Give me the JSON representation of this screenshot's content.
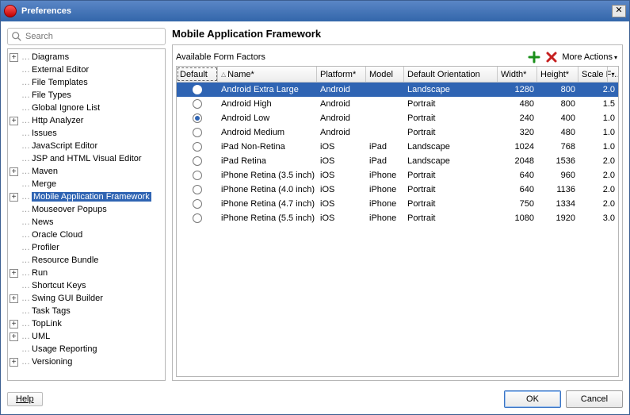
{
  "window": {
    "title": "Preferences"
  },
  "search": {
    "placeholder": "Search"
  },
  "tree": {
    "items": [
      {
        "label": "Diagrams",
        "expandable": true
      },
      {
        "label": "External Editor",
        "expandable": false
      },
      {
        "label": "File Templates",
        "expandable": false
      },
      {
        "label": "File Types",
        "expandable": false
      },
      {
        "label": "Global Ignore List",
        "expandable": false
      },
      {
        "label": "Http Analyzer",
        "expandable": true
      },
      {
        "label": "Issues",
        "expandable": false
      },
      {
        "label": "JavaScript Editor",
        "expandable": false
      },
      {
        "label": "JSP and HTML Visual Editor",
        "expandable": false
      },
      {
        "label": "Maven",
        "expandable": true
      },
      {
        "label": "Merge",
        "expandable": false
      },
      {
        "label": "Mobile Application Framework",
        "expandable": true,
        "selected": true
      },
      {
        "label": "Mouseover Popups",
        "expandable": false
      },
      {
        "label": "News",
        "expandable": false
      },
      {
        "label": "Oracle Cloud",
        "expandable": false
      },
      {
        "label": "Profiler",
        "expandable": false
      },
      {
        "label": "Resource Bundle",
        "expandable": false
      },
      {
        "label": "Run",
        "expandable": true
      },
      {
        "label": "Shortcut Keys",
        "expandable": false
      },
      {
        "label": "Swing GUI Builder",
        "expandable": true
      },
      {
        "label": "Task Tags",
        "expandable": false
      },
      {
        "label": "TopLink",
        "expandable": true
      },
      {
        "label": "UML",
        "expandable": true
      },
      {
        "label": "Usage Reporting",
        "expandable": false
      },
      {
        "label": "Versioning",
        "expandable": true
      }
    ]
  },
  "main": {
    "heading": "Mobile Application Framework",
    "available_label": "Available Form Factors",
    "more_actions": "More Actions",
    "columns": {
      "default": "Default",
      "name": "Name*",
      "platform": "Platform*",
      "model": "Model",
      "orientation": "Default Orientation",
      "width": "Width*",
      "height": "Height*",
      "scale": "Scale F…"
    },
    "rows": [
      {
        "name": "Android Extra Large",
        "platform": "Android",
        "model": "",
        "orientation": "Landscape",
        "width": "1280",
        "height": "800",
        "scale": "2.0",
        "checked": false,
        "selected": true
      },
      {
        "name": "Android High",
        "platform": "Android",
        "model": "",
        "orientation": "Portrait",
        "width": "480",
        "height": "800",
        "scale": "1.5",
        "checked": false
      },
      {
        "name": "Android Low",
        "platform": "Android",
        "model": "",
        "orientation": "Portrait",
        "width": "240",
        "height": "400",
        "scale": "1.0",
        "checked": true
      },
      {
        "name": "Android Medium",
        "platform": "Android",
        "model": "",
        "orientation": "Portrait",
        "width": "320",
        "height": "480",
        "scale": "1.0",
        "checked": false
      },
      {
        "name": "iPad Non-Retina",
        "platform": "iOS",
        "model": "iPad",
        "orientation": "Landscape",
        "width": "1024",
        "height": "768",
        "scale": "1.0",
        "checked": false
      },
      {
        "name": "iPad Retina",
        "platform": "iOS",
        "model": "iPad",
        "orientation": "Landscape",
        "width": "2048",
        "height": "1536",
        "scale": "2.0",
        "checked": false
      },
      {
        "name": "iPhone Retina (3.5 inch)",
        "platform": "iOS",
        "model": "iPhone",
        "orientation": "Portrait",
        "width": "640",
        "height": "960",
        "scale": "2.0",
        "checked": false
      },
      {
        "name": "iPhone Retina (4.0 inch)",
        "platform": "iOS",
        "model": "iPhone",
        "orientation": "Portrait",
        "width": "640",
        "height": "1136",
        "scale": "2.0",
        "checked": false
      },
      {
        "name": "iPhone Retina (4.7 inch)",
        "platform": "iOS",
        "model": "iPhone",
        "orientation": "Portrait",
        "width": "750",
        "height": "1334",
        "scale": "2.0",
        "checked": false
      },
      {
        "name": "iPhone Retina (5.5 inch)",
        "platform": "iOS",
        "model": "iPhone",
        "orientation": "Portrait",
        "width": "1080",
        "height": "1920",
        "scale": "3.0",
        "checked": false
      }
    ]
  },
  "footer": {
    "help": "Help",
    "ok": "OK",
    "cancel": "Cancel"
  }
}
